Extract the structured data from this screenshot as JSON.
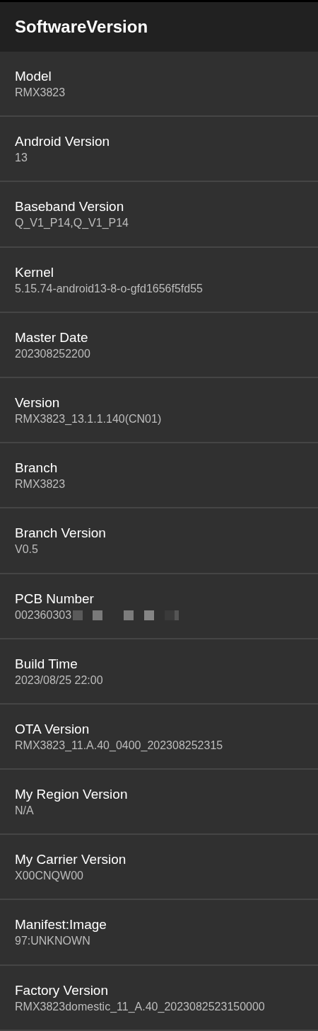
{
  "app_bar": {
    "title": "SoftwareVersion"
  },
  "items": [
    {
      "label": "Model",
      "value": "RMX3823"
    },
    {
      "label": "Android Version",
      "value": "13"
    },
    {
      "label": "Baseband Version",
      "value": "Q_V1_P14,Q_V1_P14"
    },
    {
      "label": "Kernel",
      "value": "5.15.74-android13-8-o-gfd1656f5fd55"
    },
    {
      "label": "Master Date",
      "value": "202308252200"
    },
    {
      "label": "Version",
      "value": "RMX3823_13.1.1.140(CN01)"
    },
    {
      "label": "Branch",
      "value": "RMX3823"
    },
    {
      "label": "Branch Version",
      "value": "V0.5"
    },
    {
      "label": "PCB Number",
      "value": "002360303",
      "redacted": true
    },
    {
      "label": "Build Time",
      "value": "2023/08/25 22:00"
    },
    {
      "label": "OTA Version",
      "value": "RMX3823_11.A.40_0400_202308252315"
    },
    {
      "label": "My Region Version",
      "value": "N/A"
    },
    {
      "label": "My Carrier Version",
      "value": "X00CNQW00"
    },
    {
      "label": "Manifest:Image",
      "value": "97:UNKNOWN"
    },
    {
      "label": "Factory Version",
      "value": "RMX3823domestic_11_A.40_2023082523150000"
    }
  ]
}
